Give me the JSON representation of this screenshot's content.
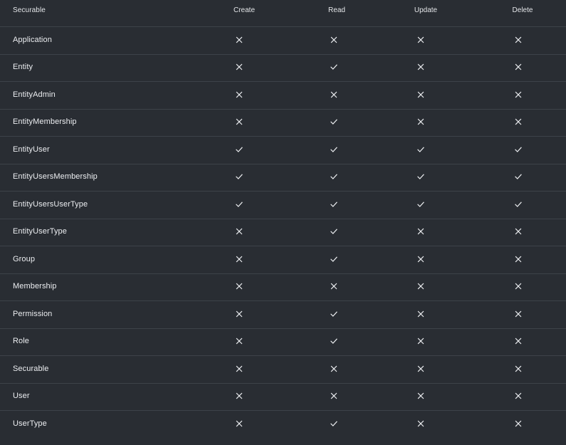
{
  "columns": {
    "name": "Securable",
    "create": "Create",
    "read": "Read",
    "update": "Update",
    "delete": "Delete"
  },
  "rows": [
    {
      "name": "Application",
      "create": false,
      "read": false,
      "update": false,
      "delete": false
    },
    {
      "name": "Entity",
      "create": false,
      "read": true,
      "update": false,
      "delete": false
    },
    {
      "name": "EntityAdmin",
      "create": false,
      "read": false,
      "update": false,
      "delete": false
    },
    {
      "name": "EntityMembership",
      "create": false,
      "read": true,
      "update": false,
      "delete": false
    },
    {
      "name": "EntityUser",
      "create": true,
      "read": true,
      "update": true,
      "delete": true
    },
    {
      "name": "EntityUsersMembership",
      "create": true,
      "read": true,
      "update": true,
      "delete": true
    },
    {
      "name": "EntityUsersUserType",
      "create": true,
      "read": true,
      "update": true,
      "delete": true
    },
    {
      "name": "EntityUserType",
      "create": false,
      "read": true,
      "update": false,
      "delete": false
    },
    {
      "name": "Group",
      "create": false,
      "read": true,
      "update": false,
      "delete": false
    },
    {
      "name": "Membership",
      "create": false,
      "read": false,
      "update": false,
      "delete": false
    },
    {
      "name": "Permission",
      "create": false,
      "read": true,
      "update": false,
      "delete": false
    },
    {
      "name": "Role",
      "create": false,
      "read": true,
      "update": false,
      "delete": false
    },
    {
      "name": "Securable",
      "create": false,
      "read": false,
      "update": false,
      "delete": false
    },
    {
      "name": "User",
      "create": false,
      "read": false,
      "update": false,
      "delete": false
    },
    {
      "name": "UserType",
      "create": false,
      "read": true,
      "update": false,
      "delete": false
    }
  ],
  "icons": {
    "allowed": "check-icon",
    "denied": "close-icon"
  },
  "colors": {
    "background": "#292d33",
    "divider": "#3d4249",
    "text": "#eceef1"
  }
}
